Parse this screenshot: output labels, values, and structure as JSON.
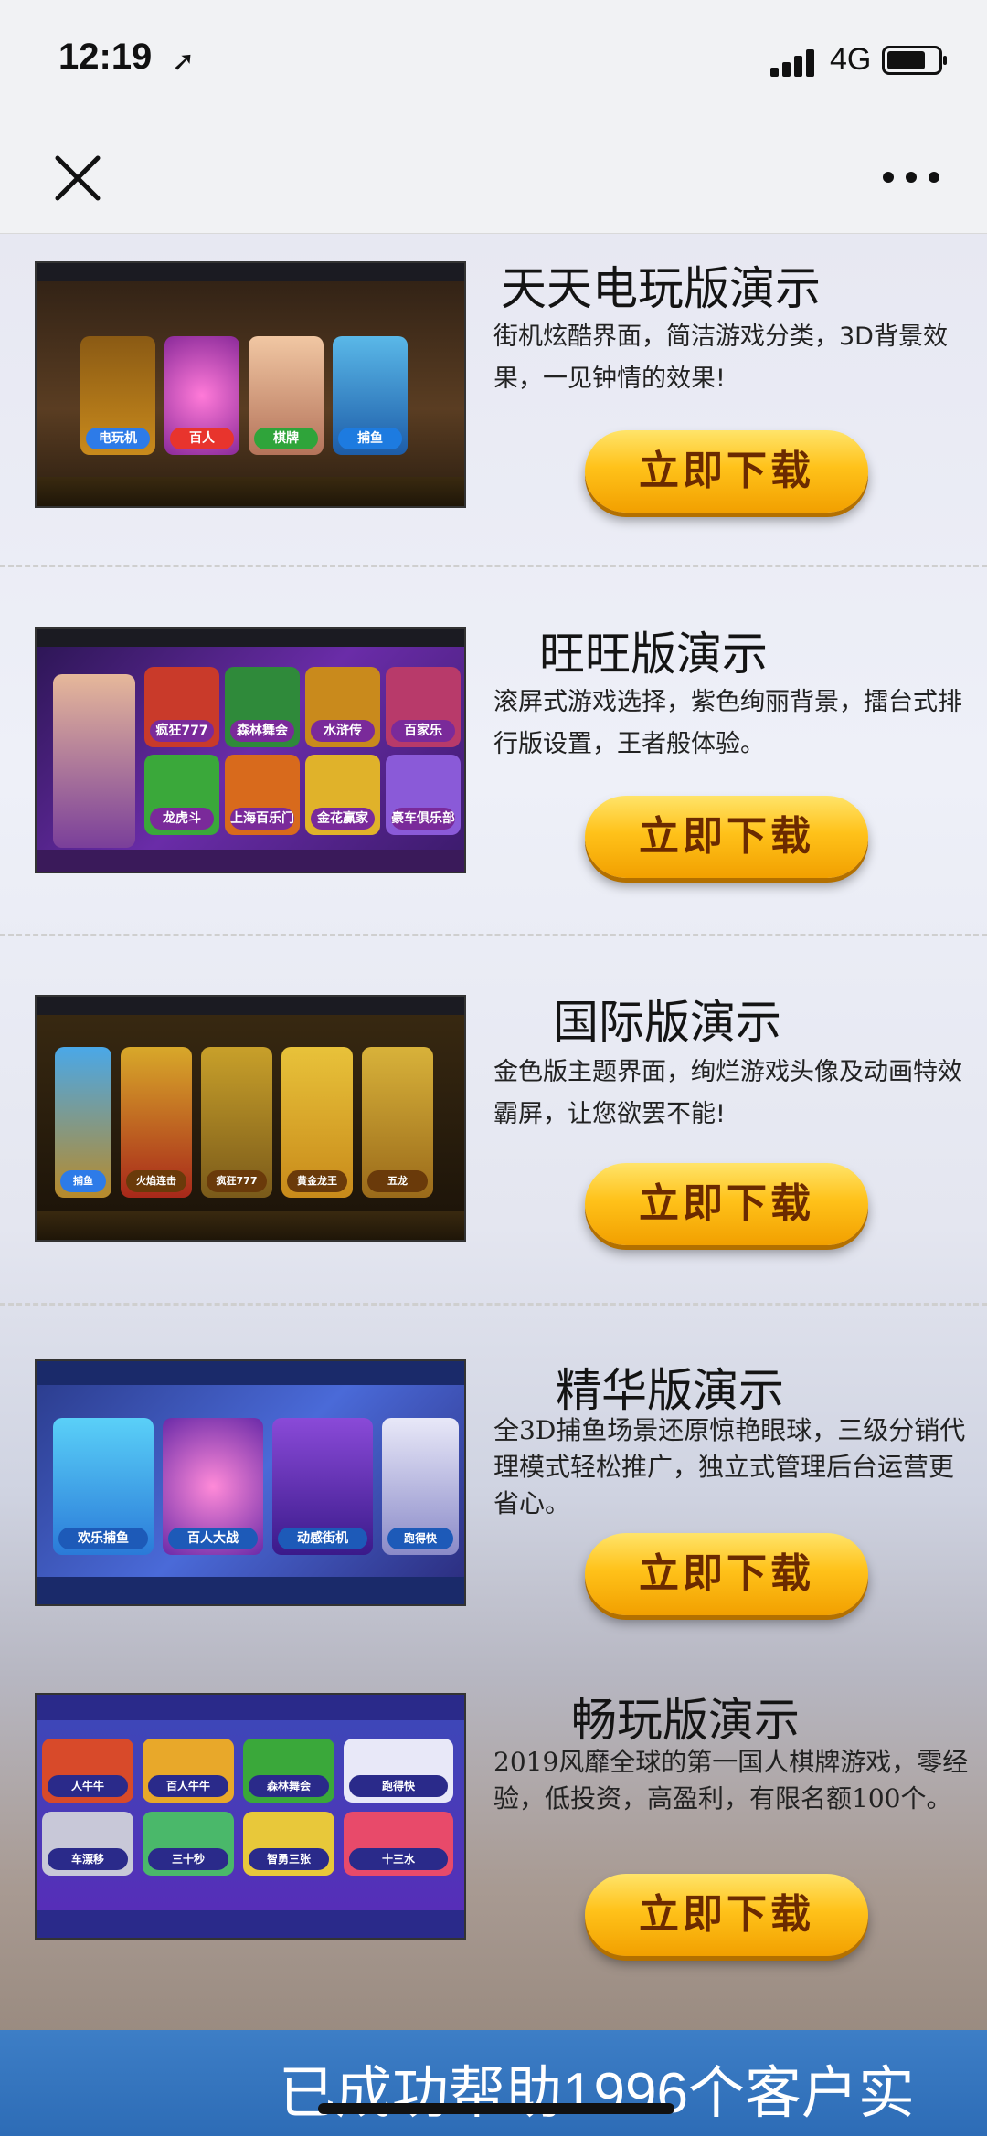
{
  "status": {
    "time": "12:19",
    "network": "4G",
    "battery_level": 0.75
  },
  "cards": [
    {
      "title": "天天电玩版演示",
      "desc": "街机炫酷界面，简洁游戏分类，3D背景效果，一见钟情的效果!",
      "button": "立即下载",
      "thumb_labels": [
        "电玩机",
        "百人",
        "棋牌",
        "捕鱼"
      ]
    },
    {
      "title": "旺旺版演示",
      "desc": "滚屏式游戏选择，紫色绚丽背景，擂台式排行版设置，王者般体验。",
      "button": "立即下载",
      "thumb_labels": [
        "疯狂777",
        "森林舞会",
        "水浒传",
        "百家乐",
        "龙虎斗",
        "上海百乐门",
        "金花赢家",
        "豪车俱乐部"
      ]
    },
    {
      "title": "国际版演示",
      "desc": "金色版主题界面，绚烂游戏头像及动画特效霸屏，让您欲罢不能!",
      "button": "立即下载",
      "thumb_labels": [
        "捕鱼",
        "火焰连击",
        "疯狂777",
        "黄金龙王",
        "五龙"
      ]
    },
    {
      "title": "精华版演示",
      "desc": "全3D捕鱼场景还原惊艳眼球，三级分销代理模式轻松推广，独立式管理后台运营更省心。",
      "button": "立即下载",
      "thumb_labels": [
        "欢乐捕鱼",
        "百人大战",
        "动感街机",
        "跑得快"
      ]
    },
    {
      "title": "畅玩版演示",
      "desc": "2019风靡全球的第一国人棋牌游戏，零经验，低投资，高盈利，有限名额100个。",
      "button": "立即下载",
      "thumb_labels": [
        "人牛牛",
        "百人牛牛",
        "森林舞会",
        "跑得快",
        "车漂移",
        "三十秒",
        "智勇三张",
        "十三水"
      ]
    }
  ],
  "banner": "已成功帮助1996个客户实",
  "icons": {
    "close": "close-icon",
    "more": "more-icon",
    "location": "location-arrow-icon"
  },
  "colors": {
    "button_gold": "#ffc21a",
    "banner_blue": "#3d7ec6"
  }
}
